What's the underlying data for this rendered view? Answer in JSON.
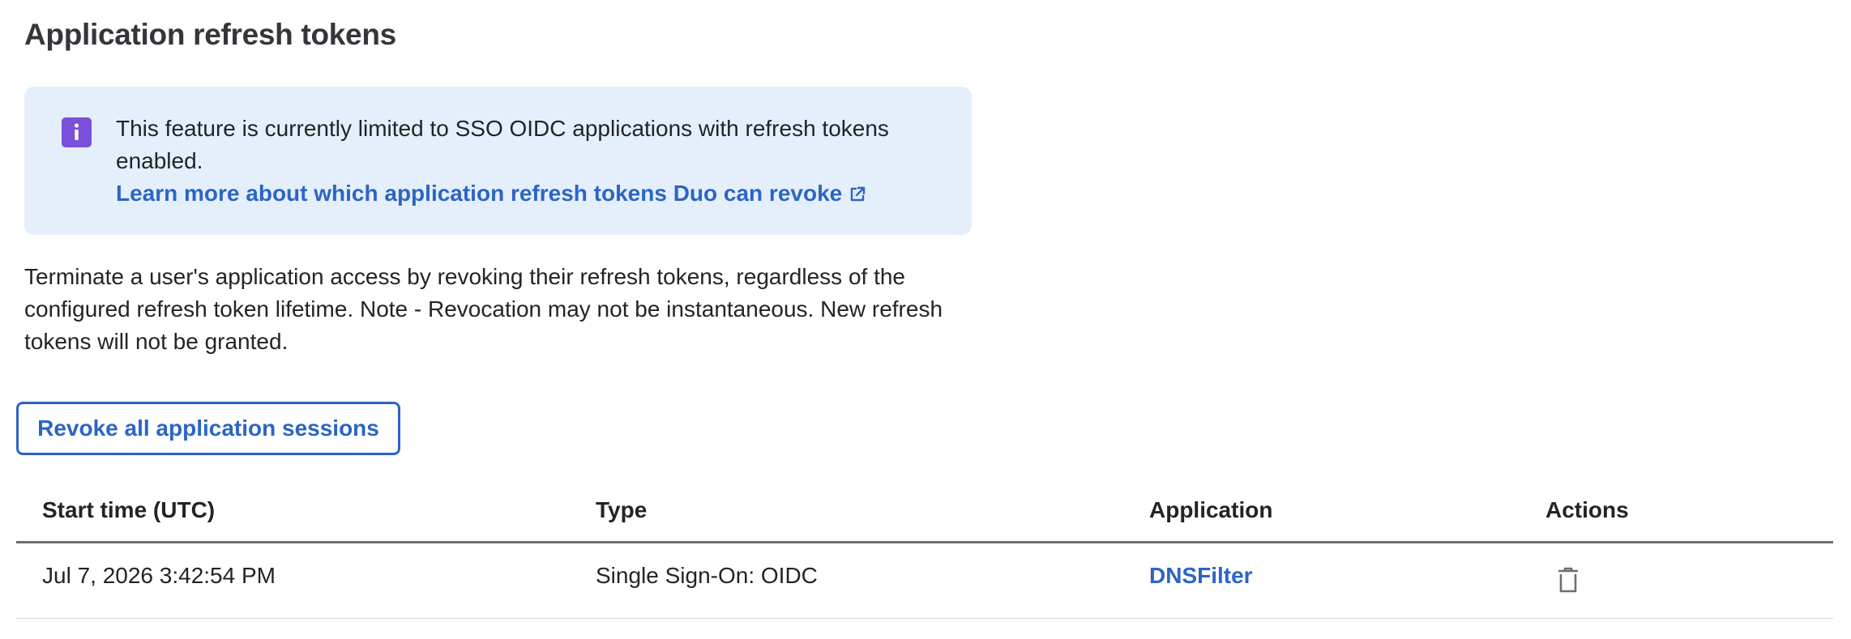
{
  "page": {
    "title": "Application refresh tokens"
  },
  "info_box": {
    "icon": "info-icon",
    "icon_color": "#7a4fd9",
    "background_color": "#e5effb",
    "text": "This feature is currently limited to SSO OIDC applications with refresh tokens enabled.",
    "link_label": "Learn more about which application refresh tokens Duo can revoke",
    "link_icon": "external-link-icon"
  },
  "description": "Terminate a user's application access by revoking their refresh tokens, regardless of the configured refresh token lifetime. Note - Revocation may not be instantaneous. New refresh tokens will not be granted.",
  "revoke_button": {
    "label": "Revoke all application sessions"
  },
  "table": {
    "columns": [
      "Start time (UTC)",
      "Type",
      "Application",
      "Actions"
    ],
    "rows": [
      {
        "start_time": "Jul 7, 2026 3:42:54 PM",
        "type": "Single Sign-On: OIDC",
        "application": "DNSFilter",
        "action_icon": "trash-icon"
      }
    ]
  },
  "colors": {
    "accent": "#2c65c4",
    "text": "#222426"
  }
}
